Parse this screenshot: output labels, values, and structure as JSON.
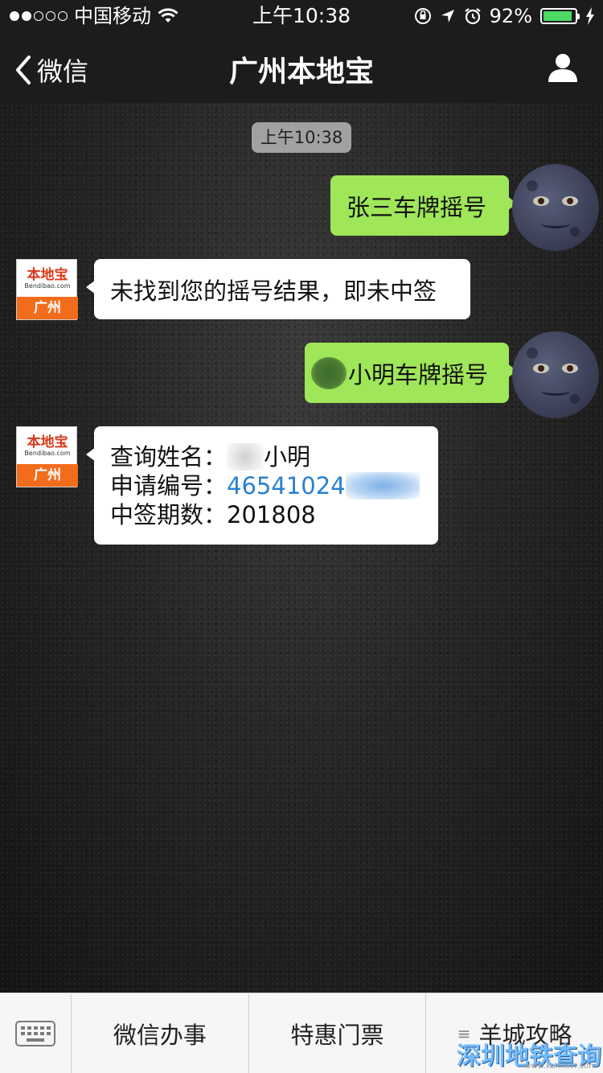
{
  "status_bar": {
    "carrier": "中国移动",
    "time": "上午10:38",
    "battery_percent": "92%",
    "battery_level": 0.92,
    "battery_color": "#4cd964"
  },
  "nav": {
    "back_label": "微信",
    "title": "广州本地宝"
  },
  "chat": {
    "timestamp": "上午10:38",
    "messages": [
      {
        "side": "right",
        "text": "张三车牌摇号"
      },
      {
        "side": "left",
        "text": "未找到您的摇号结果，即未中签"
      },
      {
        "side": "right",
        "text": "小明车牌摇号"
      },
      {
        "side": "left",
        "name_label": "查询姓名：",
        "name_value": "小明",
        "app_label": "申请编号：",
        "app_value": "46541024",
        "period_label": "中签期数：",
        "period_value": "201808"
      }
    ],
    "bot_avatar": {
      "brand": "本地宝",
      "url": "Bendibao.com",
      "city": "广州"
    }
  },
  "bottom_menu": {
    "items": [
      "微信办事",
      "特惠门票",
      "羊城攻略"
    ]
  },
  "watermark": {
    "text": "深圳地铁查询",
    "url": "www.kanxsvr.com"
  },
  "colors": {
    "accent_green": "#9fe658",
    "link_blue": "#2a7fd0",
    "brand_orange": "#f36c1b"
  }
}
